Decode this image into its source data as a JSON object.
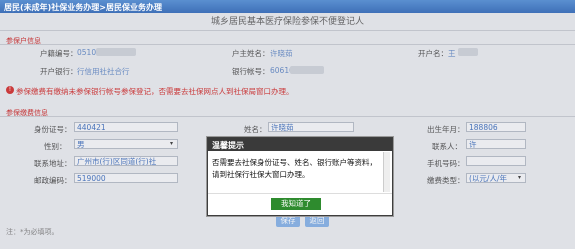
{
  "header": {
    "breadcrumb": "居民(未成年)社保业务办理>居民保业务办理"
  },
  "form": {
    "title": "城乡居民基本医疗保险参保不便登记人",
    "section1": "参保户信息",
    "section2": "参保缴费信息",
    "household_no_label": "户籍编号：",
    "household_no_value": "0510",
    "household_name_label": "户主姓名：",
    "household_name_value": "许晓茹",
    "account_name_label": "开户名：",
    "account_name_value": "王",
    "bank_label": "开户银行：",
    "bank_value": "行信用社社合行",
    "bank_account_label": "银行帐号：",
    "bank_account_value": "60610",
    "warning": "参保缴费有缴纳未参保银行帐号参保登记，否需要去社保网点人到社保局窗口办理。",
    "id_label": "身份证号：",
    "id_value": "440421",
    "name_label": "姓名：",
    "name_value": "许晓茹",
    "birth_label": "出生年月：",
    "birth_value": "188806",
    "gender_label": "性别：",
    "gender_value": "男",
    "contact_label": "联系人：",
    "contact_value": "许",
    "address_label": "联系地址：",
    "address_value": "广州市(行)区同道(行)社",
    "phone_label": "手机号码：",
    "zip_label": "邮政编码：",
    "zip_value": "519000",
    "insure_type_label": "缴费类型：",
    "insure_type_value": "(以元/人/年",
    "save_label": "保存",
    "back_label": "返回",
    "hint": "注：*为必填项。"
  },
  "dialog": {
    "title": "温馨提示",
    "body": "否需要去社保身份证号、姓名、银行账户等资料，请到社保行社保大窗口办理。",
    "ok_label": "我知道了"
  }
}
